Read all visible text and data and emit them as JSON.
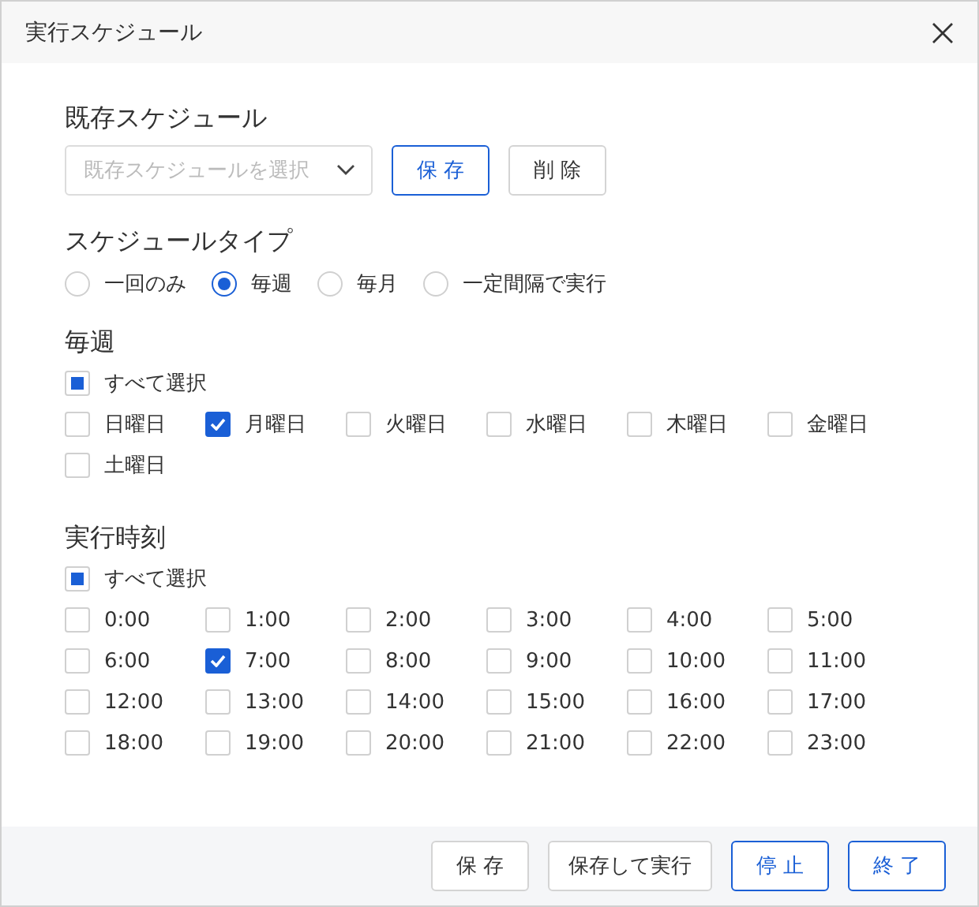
{
  "window": {
    "title": "実行スケジュール"
  },
  "existing_schedule": {
    "label": "既存スケジュール",
    "select": {
      "placeholder": "既存スケジュールを選択"
    },
    "buttons": [
      {
        "label": "保 存",
        "primary": true
      },
      {
        "label": "削 除",
        "primary": false
      }
    ]
  },
  "schedule_type": {
    "label": "スケジュールタイプ",
    "options": [
      {
        "label": "一回のみ",
        "selected": false
      },
      {
        "label": "毎週",
        "selected": true
      },
      {
        "label": "毎月",
        "selected": false
      },
      {
        "label": "一定間隔で実行",
        "selected": false
      }
    ]
  },
  "weekly": {
    "label": "毎週",
    "select_all": {
      "label": "すべて選択",
      "checked": false,
      "indeterminate": true
    },
    "items": [
      {
        "label": "日曜日",
        "checked": false
      },
      {
        "label": "月曜日",
        "checked": true
      },
      {
        "label": "火曜日",
        "checked": false
      },
      {
        "label": "水曜日",
        "checked": false
      },
      {
        "label": "木曜日",
        "checked": false
      },
      {
        "label": "金曜日",
        "checked": false
      },
      {
        "label": "土曜日",
        "checked": false
      }
    ]
  },
  "run_time": {
    "label": "実行時刻",
    "select_all": {
      "label": "すべて選択",
      "checked": false,
      "indeterminate": true
    },
    "items": [
      {
        "label": "0:00",
        "checked": false
      },
      {
        "label": "1:00",
        "checked": false
      },
      {
        "label": "2:00",
        "checked": false
      },
      {
        "label": "3:00",
        "checked": false
      },
      {
        "label": "4:00",
        "checked": false
      },
      {
        "label": "5:00",
        "checked": false
      },
      {
        "label": "6:00",
        "checked": false
      },
      {
        "label": "7:00",
        "checked": true
      },
      {
        "label": "8:00",
        "checked": false
      },
      {
        "label": "9:00",
        "checked": false
      },
      {
        "label": "10:00",
        "checked": false
      },
      {
        "label": "11:00",
        "checked": false
      },
      {
        "label": "12:00",
        "checked": false
      },
      {
        "label": "13:00",
        "checked": false
      },
      {
        "label": "14:00",
        "checked": false
      },
      {
        "label": "15:00",
        "checked": false
      },
      {
        "label": "16:00",
        "checked": false
      },
      {
        "label": "17:00",
        "checked": false
      },
      {
        "label": "18:00",
        "checked": false
      },
      {
        "label": "19:00",
        "checked": false
      },
      {
        "label": "20:00",
        "checked": false
      },
      {
        "label": "21:00",
        "checked": false
      },
      {
        "label": "22:00",
        "checked": false
      },
      {
        "label": "23:00",
        "checked": false
      }
    ]
  },
  "footer": {
    "buttons": [
      {
        "label": "保 存",
        "primary": false
      },
      {
        "label": "保存して実行",
        "primary": false
      },
      {
        "label": "停 止",
        "primary": true
      },
      {
        "label": "終 了",
        "primary": true
      }
    ]
  }
}
